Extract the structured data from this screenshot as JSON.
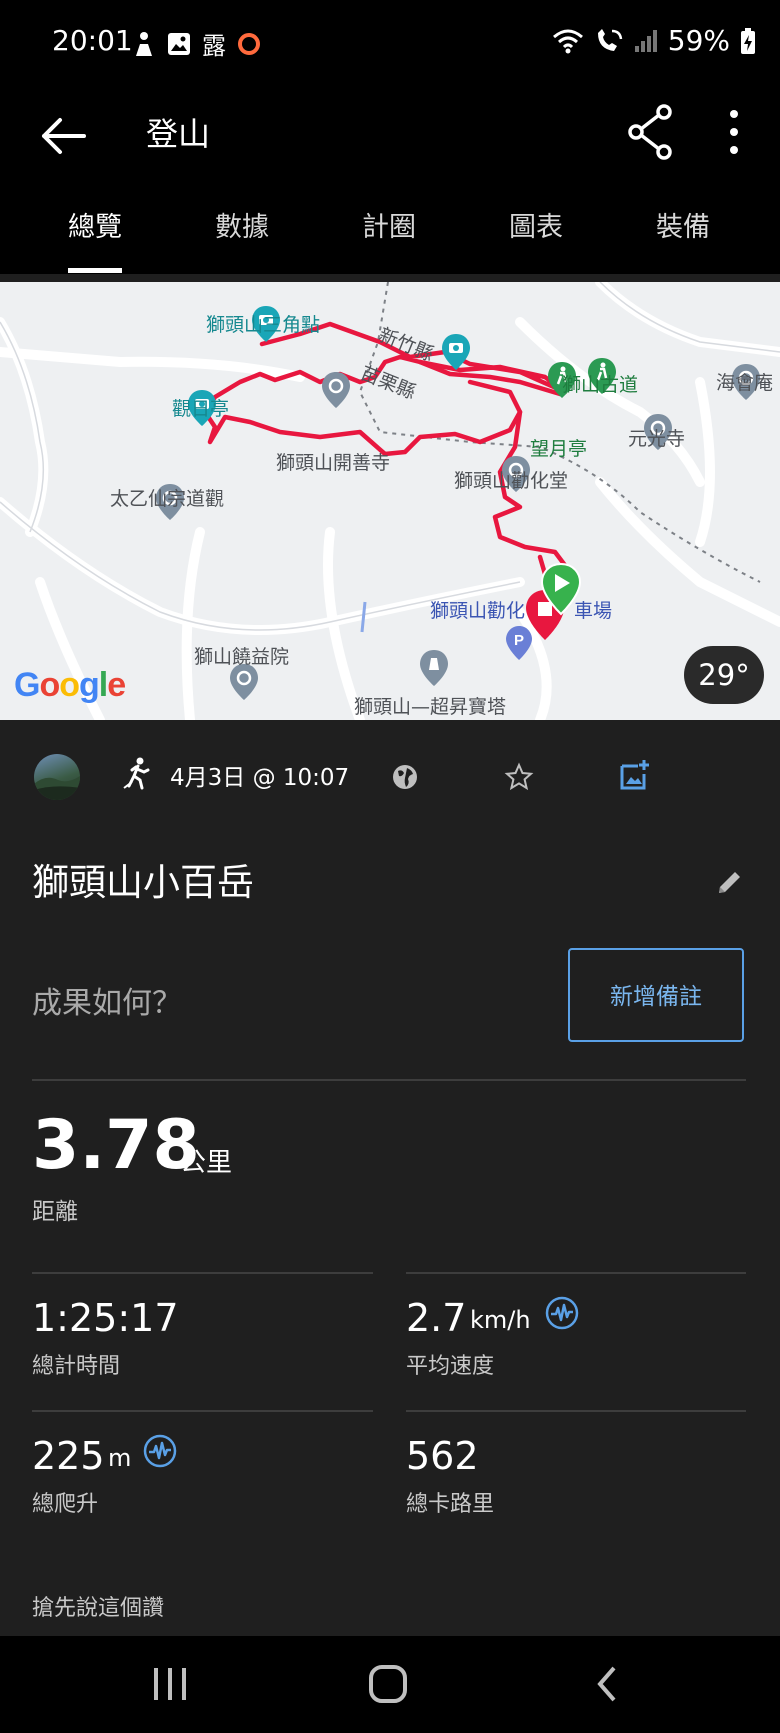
{
  "status_bar": {
    "time": "20:01",
    "notif_glyph": "露",
    "battery": "59%",
    "icons": [
      "notification-person-icon",
      "gallery-icon",
      "weather-glyph-icon",
      "record-icon",
      "wifi-icon",
      "wifi-call-icon",
      "signal-icon",
      "battery-charging-icon"
    ]
  },
  "app_bar": {
    "title": "登山",
    "icons": [
      "back-arrow-icon",
      "share-icon",
      "more-vert-icon"
    ]
  },
  "tabs": [
    {
      "label": "總覽",
      "active": true
    },
    {
      "label": "數據",
      "active": false
    },
    {
      "label": "計圈",
      "active": false
    },
    {
      "label": "圖表",
      "active": false
    },
    {
      "label": "裝備",
      "active": false
    }
  ],
  "map": {
    "labels": {
      "triangle_point": "獅頭山三角點",
      "hsinchu": "新竹縣",
      "miaoli": "苗栗縣",
      "lion_trail": "獅山古道",
      "haihui": "海會庵",
      "guanri": "觀日亭",
      "wangyue": "望月亭",
      "yuanguang": "元光寺",
      "kaishan": "獅頭山開善寺",
      "quanhua": "獅頭山勸化堂",
      "taiyi": "太乙仙宗道觀",
      "parking": "獅頭山勸化",
      "parking2": "車場",
      "raoyi": "獅山饒益院",
      "tower": "獅頭山—超昇寶塔",
      "google": "Google"
    },
    "temperature": "29°",
    "route_color": "#e8173f",
    "start_color": "#37b24d"
  },
  "activity": {
    "date": "4月3日 @ 10:07",
    "name": "獅頭山小百岳",
    "prompt": "成果如何？",
    "add_note_label": "新增備註",
    "icons": [
      "avatar",
      "hiking-icon",
      "globe-icon",
      "star-icon",
      "add-photo-icon",
      "edit-pencil-icon"
    ]
  },
  "stats": {
    "distance": {
      "value": "3.78",
      "unit": "公里",
      "label": "距離"
    },
    "total_time": {
      "value": "1:25:17",
      "label": "總計時間"
    },
    "avg_speed": {
      "value": "2.7",
      "unit": "km/h",
      "label": "平均速度"
    },
    "ascent": {
      "value": "225",
      "unit": "m",
      "label": "總爬升"
    },
    "calories": {
      "value": "562",
      "label": "總卡路里"
    }
  },
  "kudos_text": "搶先說這個讚",
  "accent_color": "#5aa0e6"
}
